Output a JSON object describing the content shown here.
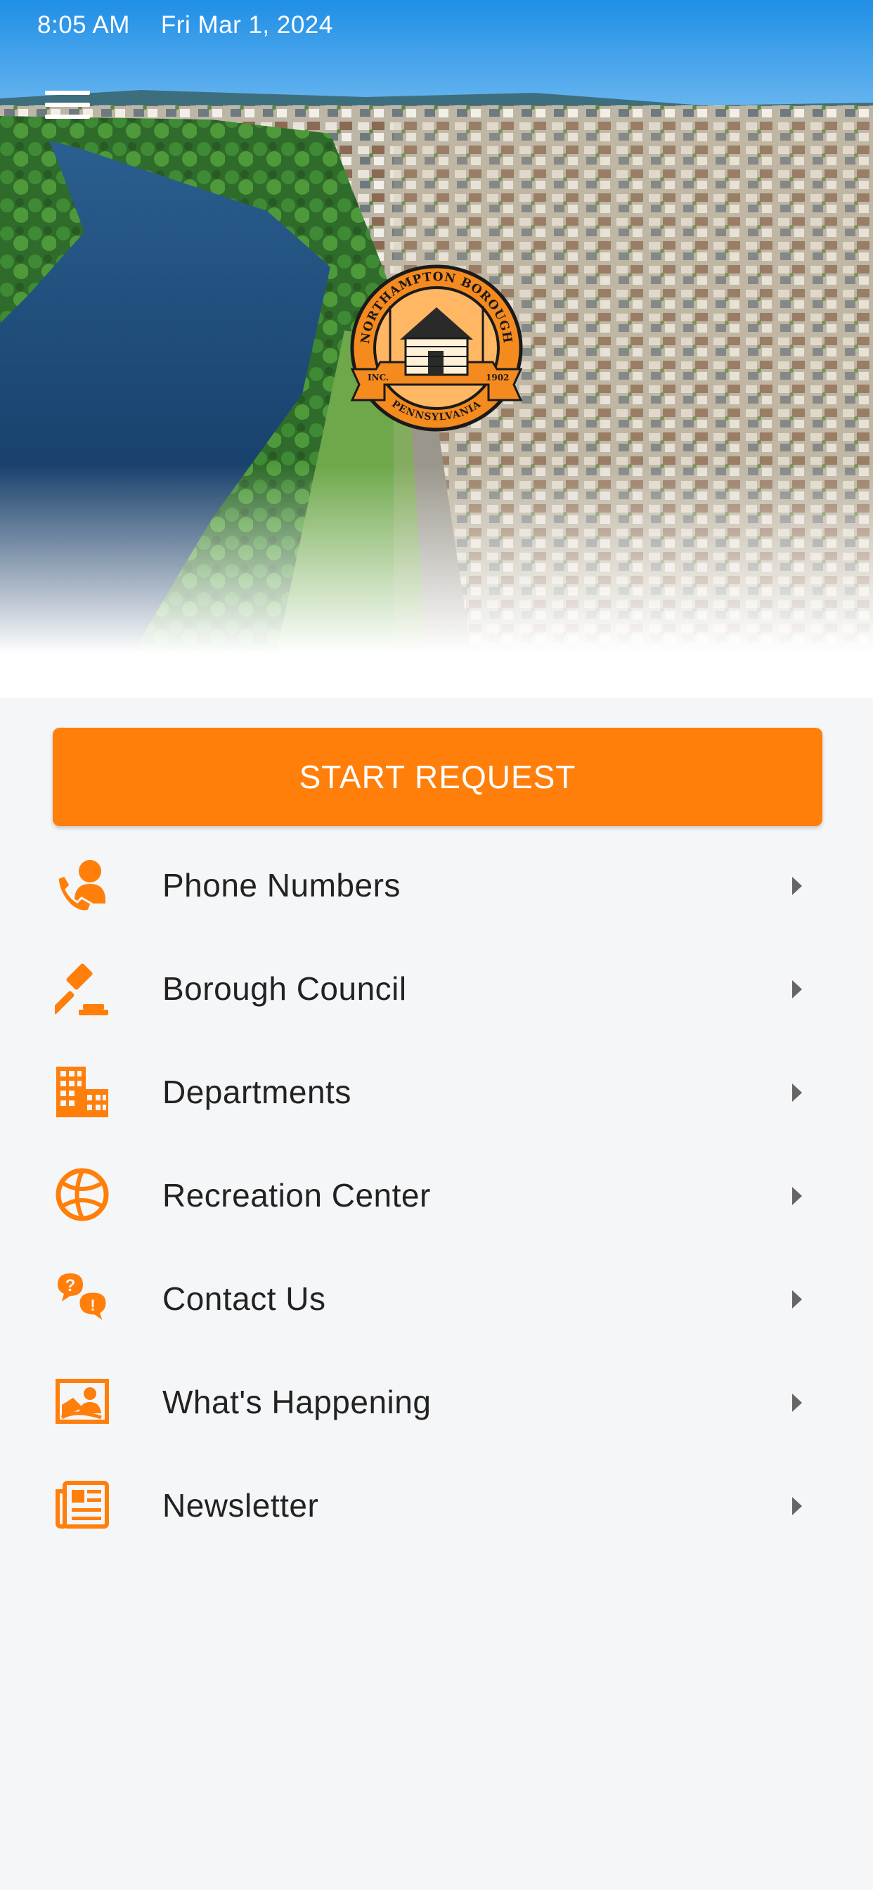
{
  "status_bar": {
    "time": "8:05 AM",
    "date": "Fri Mar 1, 2024"
  },
  "header": {
    "menu_icon": "hamburger-menu-icon",
    "seal": {
      "arc_top": "NORTHAMPTON BOROUGH",
      "arc_bottom": "PENNSYLVANIA",
      "left_tag": "INC.",
      "right_tag": "1902"
    }
  },
  "main": {
    "start_request_label": "START REQUEST",
    "items": [
      {
        "label": "Phone Numbers",
        "icon": "phone-user-icon"
      },
      {
        "label": "Borough Council",
        "icon": "gavel-icon"
      },
      {
        "label": "Departments",
        "icon": "building-icon"
      },
      {
        "label": "Recreation Center",
        "icon": "basketball-icon"
      },
      {
        "label": "Contact Us",
        "icon": "question-exclamation-chat-icon"
      },
      {
        "label": "What's Happening",
        "icon": "image-portrait-icon"
      },
      {
        "label": "Newsletter",
        "icon": "newspaper-icon"
      }
    ]
  },
  "colors": {
    "accent": "#ff7f0a",
    "text": "#222222",
    "background": "#f5f6f8",
    "chevron": "#666666"
  }
}
